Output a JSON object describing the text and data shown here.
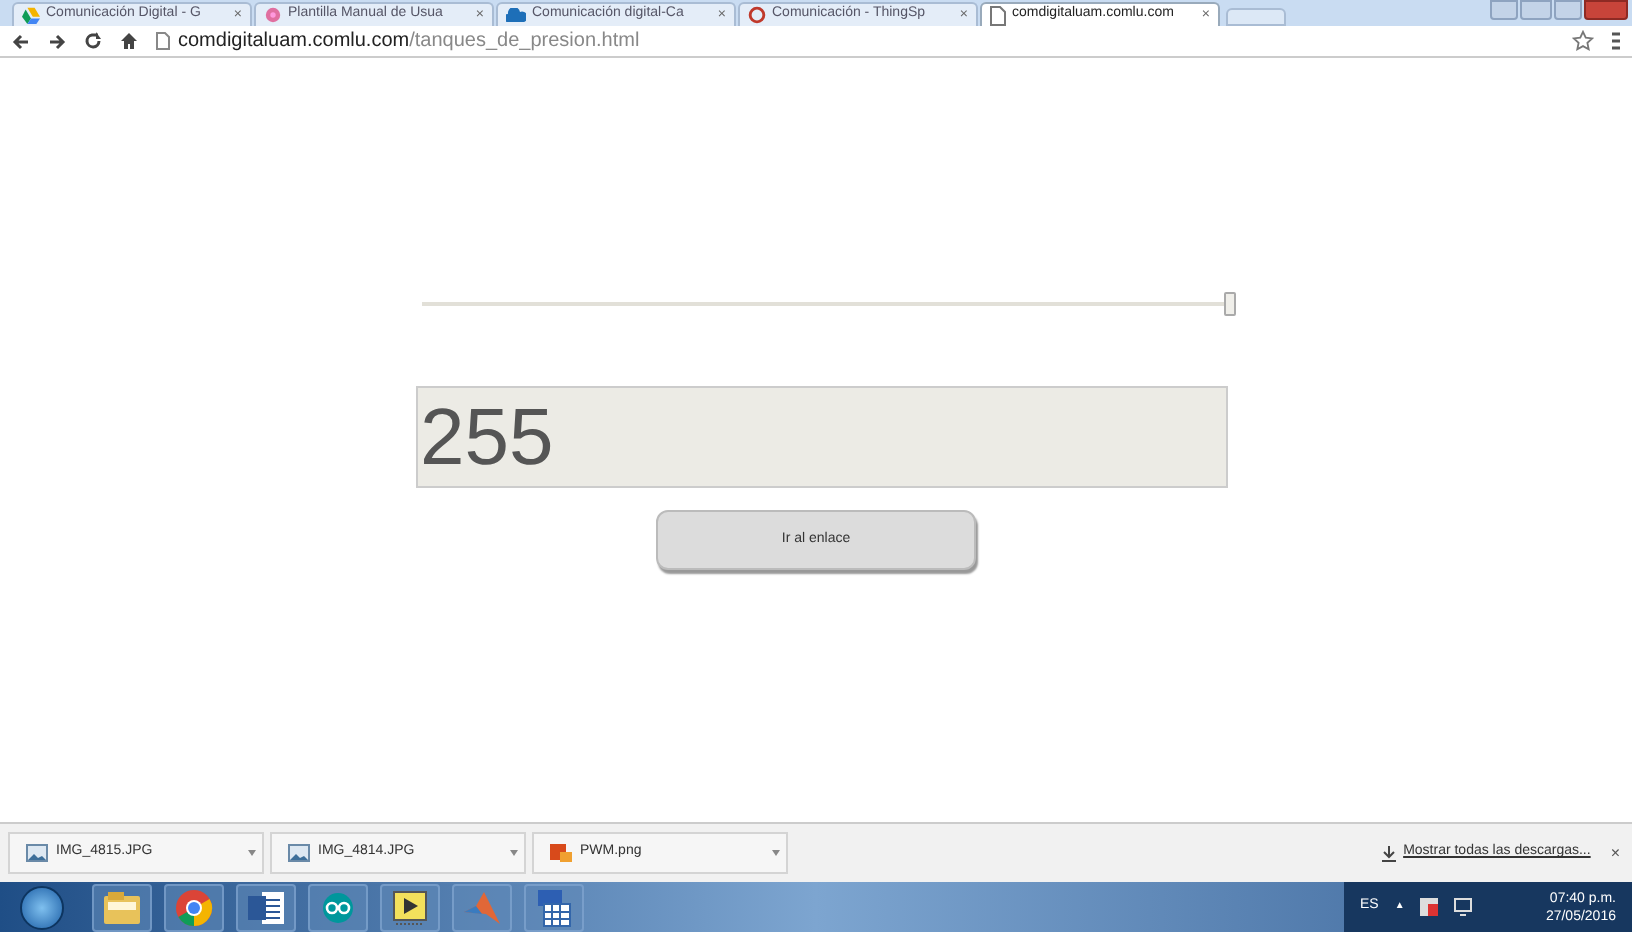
{
  "tabs": [
    {
      "title": "Comunicación Digital - G",
      "selected": false,
      "kind": "drive"
    },
    {
      "title": "Plantilla Manual de Usua",
      "selected": false,
      "kind": "sheet"
    },
    {
      "title": "Comunicación digital-Ca",
      "selected": false,
      "kind": "cloud"
    },
    {
      "title": "Comunicación - ThingSp",
      "selected": false,
      "kind": "ring"
    },
    {
      "title": "comdigitaluam.comlu.com",
      "selected": true,
      "kind": "page"
    }
  ],
  "tab_close": "×",
  "address": {
    "host": "comdigitaluam.comlu.com",
    "path": "/tanques_de_presion.html"
  },
  "page": {
    "slider": {
      "level": 1.0
    },
    "value_field": {
      "value": "255"
    },
    "button": "Ir al enlace"
  },
  "downloads": {
    "items": [
      {
        "name": "IMG_4815.JPG",
        "kind": "image"
      },
      {
        "name": "IMG_4814.JPG",
        "kind": "image"
      },
      {
        "name": "PWM.png",
        "kind": "png"
      }
    ],
    "show_all": "Mostrar todas las descargas...",
    "close": "×"
  },
  "taskbar": {
    "apps": [
      {
        "kind": "folder"
      },
      {
        "kind": "chrome"
      },
      {
        "kind": "word"
      },
      {
        "kind": "arduino"
      },
      {
        "kind": "labview"
      },
      {
        "kind": "matlab"
      },
      {
        "kind": "calc"
      }
    ],
    "language": "ES",
    "tray_arrow": "▲",
    "time": "07:40 p.m.",
    "date": "27/05/2016"
  }
}
